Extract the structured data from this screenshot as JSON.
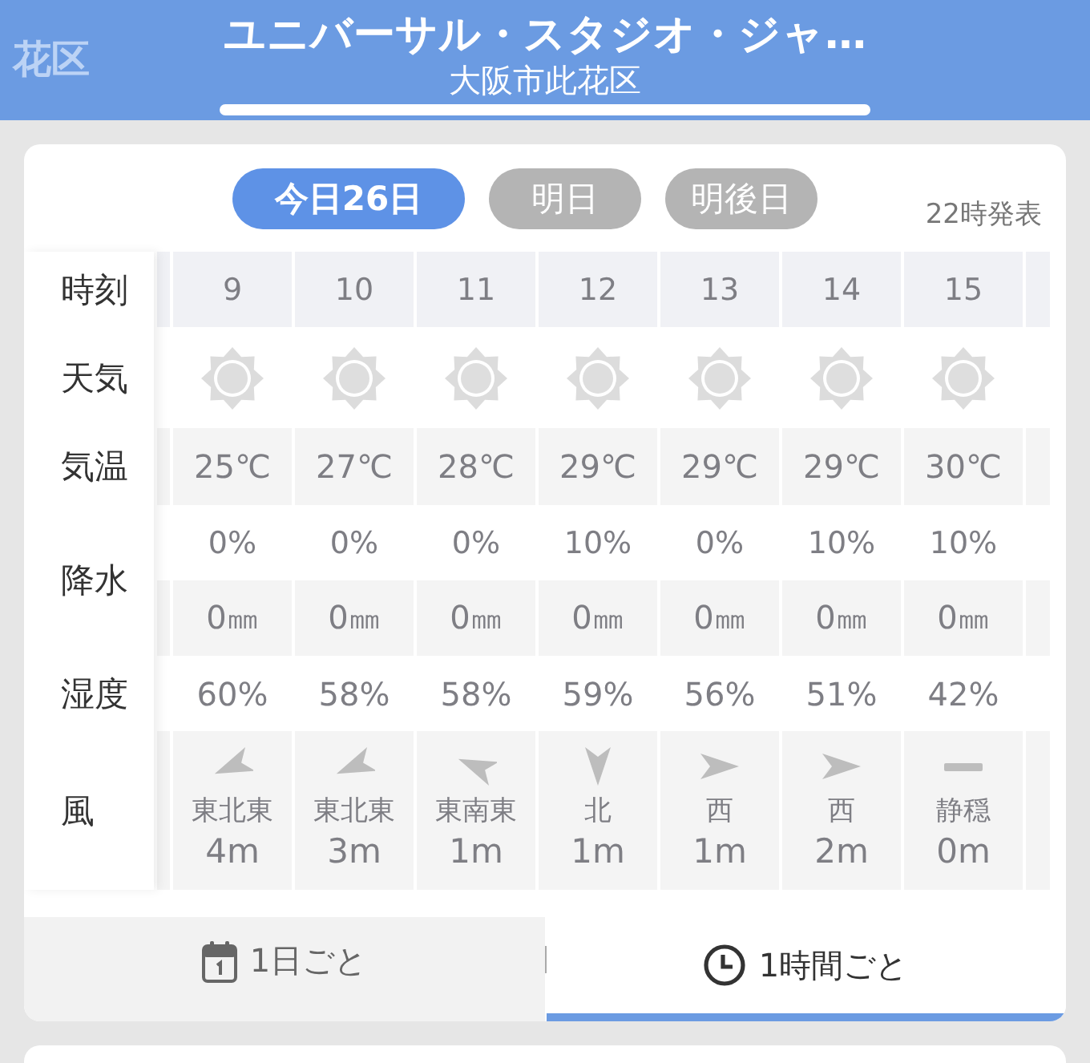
{
  "header": {
    "faded_title": "花区",
    "title": "ユニバーサル・スタジオ・ジャ…",
    "subtitle": "大阪市此花区"
  },
  "day_tabs": [
    {
      "label": "今日26日",
      "selected": true
    },
    {
      "label": "明日",
      "selected": false
    },
    {
      "label": "明後日",
      "selected": false
    }
  ],
  "issued": "22時発表",
  "table": {
    "row_labels": [
      {
        "label": "時刻",
        "kind": "single"
      },
      {
        "label": "天気",
        "kind": "single"
      },
      {
        "label": "気温",
        "kind": "single"
      },
      {
        "label": "降水",
        "kind": "double"
      },
      {
        "label": "湿度",
        "kind": "single"
      },
      {
        "label": "風",
        "kind": "single"
      }
    ],
    "hours": [
      {
        "time": "9",
        "weather": {
          "kind": "sunny"
        },
        "temperature": "25℃",
        "precip_chance": "0%",
        "precip_amount": "0㎜",
        "humidity": "60%",
        "wind": {
          "kind": "wsw",
          "direction": "東北東",
          "speed": "4m"
        }
      },
      {
        "time": "10",
        "weather": {
          "kind": "sunny"
        },
        "temperature": "27℃",
        "precip_chance": "0%",
        "precip_amount": "0㎜",
        "humidity": "58%",
        "wind": {
          "kind": "wsw",
          "direction": "東北東",
          "speed": "3m"
        }
      },
      {
        "time": "11",
        "weather": {
          "kind": "sunny"
        },
        "temperature": "28℃",
        "precip_chance": "0%",
        "precip_amount": "0㎜",
        "humidity": "58%",
        "wind": {
          "kind": "wnw",
          "direction": "東南東",
          "speed": "1m"
        }
      },
      {
        "time": "12",
        "weather": {
          "kind": "sunny"
        },
        "temperature": "29℃",
        "precip_chance": "10%",
        "precip_amount": "0㎜",
        "humidity": "59%",
        "wind": {
          "kind": "s",
          "direction": "北",
          "speed": "1m"
        }
      },
      {
        "time": "13",
        "weather": {
          "kind": "sunny"
        },
        "temperature": "29℃",
        "precip_chance": "0%",
        "precip_amount": "0㎜",
        "humidity": "56%",
        "wind": {
          "kind": "e",
          "direction": "西",
          "speed": "1m"
        }
      },
      {
        "time": "14",
        "weather": {
          "kind": "sunny"
        },
        "temperature": "29℃",
        "precip_chance": "10%",
        "precip_amount": "0㎜",
        "humidity": "51%",
        "wind": {
          "kind": "e",
          "direction": "西",
          "speed": "2m"
        }
      },
      {
        "time": "15",
        "weather": {
          "kind": "sunny"
        },
        "temperature": "30℃",
        "precip_chance": "10%",
        "precip_amount": "0㎜",
        "humidity": "42%",
        "wind": {
          "kind": "calm",
          "direction": "静穏",
          "speed": "0m"
        }
      }
    ]
  },
  "bottom_tabs": [
    {
      "label": "1日ごと",
      "kind": "daily",
      "selected": false
    },
    {
      "label": "1時間ごと",
      "kind": "hourly",
      "selected": true
    }
  ]
}
